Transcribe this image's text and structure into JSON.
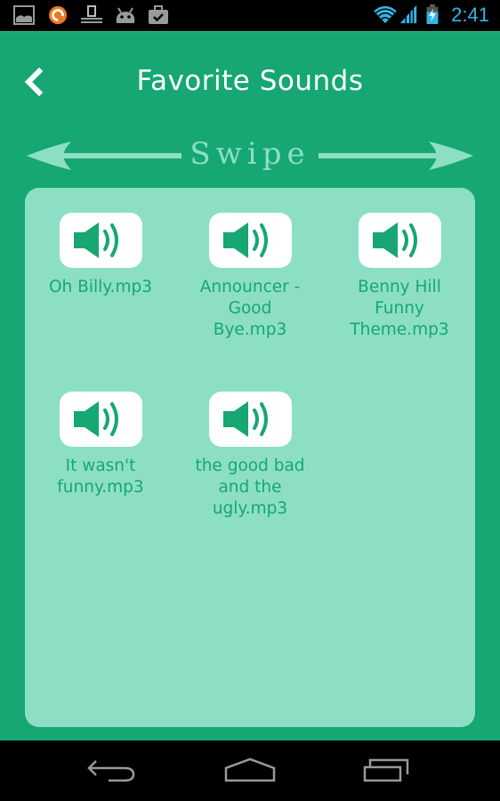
{
  "status_bar": {
    "time": "2:41",
    "left_icons": [
      "gallery-icon",
      "orange-app-icon",
      "national-geographic-icon",
      "android-icon",
      "briefcase-check-icon"
    ],
    "right_icons": [
      "wifi-icon",
      "signal-icon",
      "battery-charging-icon"
    ],
    "accent_color": "#33b5e5"
  },
  "header": {
    "title": "Favorite Sounds",
    "back_icon": "chevron-left-icon"
  },
  "swipe_hint": {
    "label": "Swipe",
    "left_icon": "arrow-left-icon",
    "right_icon": "arrow-right-icon"
  },
  "sounds": [
    {
      "label": "Oh Billy.mp3",
      "icon": "speaker-icon"
    },
    {
      "label": "Announcer  - Good Bye.mp3",
      "icon": "speaker-icon"
    },
    {
      "label": "Benny Hill Funny Theme.mp3",
      "icon": "speaker-icon"
    },
    {
      "label": "It wasn't funny.mp3",
      "icon": "speaker-icon"
    },
    {
      "label": "the good bad and the ugly.mp3",
      "icon": "speaker-icon"
    }
  ],
  "nav_bar": {
    "buttons": [
      "back-icon",
      "home-icon",
      "recents-icon"
    ]
  },
  "colors": {
    "primary": "#16a772",
    "panel": "#8cdfc5",
    "swipe": "#8cdfc3",
    "white": "#ffffff"
  }
}
